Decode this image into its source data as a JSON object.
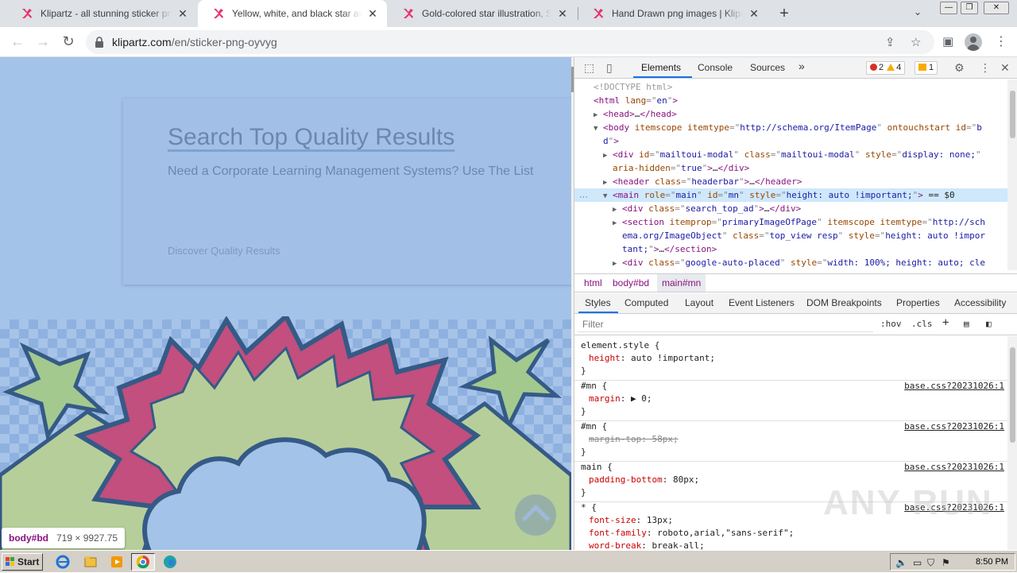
{
  "browser": {
    "tabs": [
      {
        "title": "Klipartz - all stunning sticker png ima",
        "active": false
      },
      {
        "title": "Yellow, white, and black star and clo",
        "active": true
      },
      {
        "title": "Gold-colored star illustration, Star De",
        "active": false
      },
      {
        "title": "Hand Drawn png images | Klipartz",
        "active": false
      }
    ],
    "url_host": "klipartz.com",
    "url_path": "/en/sticker-png-oyvyg",
    "win_min": "—",
    "win_restore": "❐",
    "win_close": "✕"
  },
  "page": {
    "ad_title": "Search Top Quality Results",
    "ad_subtitle": "Need a Corporate Learning Management Systems? Use The List",
    "ad_footer": "Discover Quality Results",
    "inspect_tag": "body#bd",
    "inspect_size": "719 × 9927.75"
  },
  "devtools": {
    "tabs": [
      "Elements",
      "Console",
      "Sources"
    ],
    "more": "»",
    "errors": "2",
    "warnings": "4",
    "issues": "1",
    "dom": [
      {
        "indent": 0,
        "tri": "",
        "parts": [
          [
            "c",
            "<!DOCTYPE html>"
          ]
        ]
      },
      {
        "indent": 0,
        "tri": "",
        "parts": [
          [
            "t",
            "<html "
          ],
          [
            "a",
            "lang"
          ],
          [
            "e",
            "=\""
          ],
          [
            "v",
            "en"
          ],
          [
            "e",
            "\""
          ],
          [
            "t",
            ">"
          ]
        ]
      },
      {
        "indent": 1,
        "tri": "▶",
        "parts": [
          [
            "t",
            "<head>"
          ],
          [
            "x",
            "…"
          ],
          [
            "t",
            "</head>"
          ]
        ]
      },
      {
        "indent": 1,
        "tri": "▼",
        "parts": [
          [
            "t",
            "<body "
          ],
          [
            "a",
            "itemscope"
          ],
          [
            "t",
            " "
          ],
          [
            "a",
            "itemtype"
          ],
          [
            "e",
            "=\""
          ],
          [
            "v",
            "http://schema.org/ItemPage"
          ],
          [
            "e",
            "\""
          ],
          [
            "t",
            " "
          ],
          [
            "a",
            "ontouchstart"
          ],
          [
            "t",
            " "
          ],
          [
            "a",
            "id"
          ],
          [
            "e",
            "=\""
          ],
          [
            "v",
            "b"
          ]
        ]
      },
      {
        "indent": 1,
        "tri": "",
        "parts": [
          [
            "v",
            "d"
          ],
          [
            "e",
            "\""
          ],
          [
            "t",
            ">"
          ]
        ]
      },
      {
        "indent": 2,
        "tri": "▶",
        "parts": [
          [
            "t",
            "<div "
          ],
          [
            "a",
            "id"
          ],
          [
            "e",
            "=\""
          ],
          [
            "v",
            "mailtoui-modal"
          ],
          [
            "e",
            "\""
          ],
          [
            "t",
            " "
          ],
          [
            "a",
            "class"
          ],
          [
            "e",
            "=\""
          ],
          [
            "v",
            "mailtoui-modal"
          ],
          [
            "e",
            "\""
          ],
          [
            "t",
            " "
          ],
          [
            "a",
            "style"
          ],
          [
            "e",
            "=\""
          ],
          [
            "v",
            "display: none;"
          ],
          [
            "e",
            "\""
          ]
        ]
      },
      {
        "indent": 2,
        "tri": "",
        "parts": [
          [
            "a",
            "aria-hidden"
          ],
          [
            "e",
            "=\""
          ],
          [
            "v",
            "true"
          ],
          [
            "e",
            "\""
          ],
          [
            "t",
            ">"
          ],
          [
            "x",
            "…"
          ],
          [
            "t",
            "</div>"
          ]
        ]
      },
      {
        "indent": 2,
        "tri": "▶",
        "parts": [
          [
            "t",
            "<header "
          ],
          [
            "a",
            "class"
          ],
          [
            "e",
            "=\""
          ],
          [
            "v",
            "headerbar"
          ],
          [
            "e",
            "\""
          ],
          [
            "t",
            ">"
          ],
          [
            "x",
            "…"
          ],
          [
            "t",
            "</header>"
          ]
        ]
      },
      {
        "indent": 2,
        "tri": "▼",
        "sel": true,
        "parts": [
          [
            "t",
            "<main "
          ],
          [
            "a",
            "role"
          ],
          [
            "e",
            "=\""
          ],
          [
            "v",
            "main"
          ],
          [
            "e",
            "\""
          ],
          [
            "t",
            " "
          ],
          [
            "a",
            "id"
          ],
          [
            "e",
            "=\""
          ],
          [
            "v",
            "mn"
          ],
          [
            "e",
            "\""
          ],
          [
            "t",
            " "
          ],
          [
            "a",
            "style"
          ],
          [
            "e",
            "=\""
          ],
          [
            "v",
            "height: auto !important;"
          ],
          [
            "e",
            "\""
          ],
          [
            "t",
            ">"
          ],
          [
            "x",
            " == $0"
          ]
        ]
      },
      {
        "indent": 3,
        "tri": "▶",
        "parts": [
          [
            "t",
            "<div "
          ],
          [
            "a",
            "class"
          ],
          [
            "e",
            "=\""
          ],
          [
            "v",
            "search_top_ad"
          ],
          [
            "e",
            "\""
          ],
          [
            "t",
            ">"
          ],
          [
            "x",
            "…"
          ],
          [
            "t",
            "</div>"
          ]
        ]
      },
      {
        "indent": 3,
        "tri": "▶",
        "parts": [
          [
            "t",
            "<section "
          ],
          [
            "a",
            "itemprop"
          ],
          [
            "e",
            "=\""
          ],
          [
            "v",
            "primaryImageOfPage"
          ],
          [
            "e",
            "\""
          ],
          [
            "t",
            " "
          ],
          [
            "a",
            "itemscope"
          ],
          [
            "t",
            " "
          ],
          [
            "a",
            "itemtype"
          ],
          [
            "e",
            "=\""
          ],
          [
            "v",
            "http://sch"
          ]
        ]
      },
      {
        "indent": 3,
        "tri": "",
        "parts": [
          [
            "v",
            "ema.org/ImageObject"
          ],
          [
            "e",
            "\""
          ],
          [
            "t",
            " "
          ],
          [
            "a",
            "class"
          ],
          [
            "e",
            "=\""
          ],
          [
            "v",
            "top_view resp"
          ],
          [
            "e",
            "\""
          ],
          [
            "t",
            " "
          ],
          [
            "a",
            "style"
          ],
          [
            "e",
            "=\""
          ],
          [
            "v",
            "height: auto !impor"
          ]
        ]
      },
      {
        "indent": 3,
        "tri": "",
        "parts": [
          [
            "v",
            "tant;"
          ],
          [
            "e",
            "\""
          ],
          [
            "t",
            ">"
          ],
          [
            "x",
            "…"
          ],
          [
            "t",
            "</section>"
          ]
        ]
      },
      {
        "indent": 3,
        "tri": "▶",
        "parts": [
          [
            "t",
            "<div "
          ],
          [
            "a",
            "class"
          ],
          [
            "e",
            "=\""
          ],
          [
            "v",
            "google-auto-placed"
          ],
          [
            "e",
            "\""
          ],
          [
            "t",
            " "
          ],
          [
            "a",
            "style"
          ],
          [
            "e",
            "=\""
          ],
          [
            "v",
            "width: 100%; height: auto; cle"
          ]
        ]
      }
    ],
    "dom_dots": "···",
    "crumbs": [
      "html",
      "body#bd",
      "main#mn"
    ],
    "pane_tabs": [
      "Styles",
      "Computed",
      "Layout",
      "Event Listeners",
      "DOM Breakpoints",
      "Properties",
      "Accessibility"
    ],
    "filter_placeholder": "Filter",
    "hov": ":hov",
    "cls": ".cls",
    "rules": [
      {
        "selector": "element.style {",
        "src": "",
        "decls": [
          {
            "p": "height",
            "v": "auto !important;",
            "strike": false
          }
        ]
      },
      {
        "selector": "#mn {",
        "src": "base.css?20231026:1",
        "decls": [
          {
            "p": "margin",
            "v": "▶ 0;",
            "strike": false
          }
        ]
      },
      {
        "selector": "#mn {",
        "src": "base.css?20231026:1",
        "decls": [
          {
            "p": "margin-top",
            "v": "58px;",
            "strike": true
          }
        ]
      },
      {
        "selector": "main {",
        "src": "base.css?20231026:1",
        "decls": [
          {
            "p": "padding-bottom",
            "v": "80px;",
            "strike": false
          }
        ]
      },
      {
        "selector": "* {",
        "src": "base.css?20231026:1",
        "decls": [
          {
            "p": "font-size",
            "v": "13px;",
            "strike": false
          },
          {
            "p": "font-family",
            "v": "roboto,arial,\"sans-serif\";",
            "strike": false
          },
          {
            "p": "word-break",
            "v": "break-all;",
            "strike": false
          }
        ]
      }
    ]
  },
  "watermark": "ANY RUN",
  "taskbar": {
    "start": "Start",
    "clock": "8:50 PM"
  },
  "colors": {
    "accent": "#1a73e8",
    "klipartz_pink": "#e8336d",
    "overlay_blue": "#a4c3e8"
  }
}
